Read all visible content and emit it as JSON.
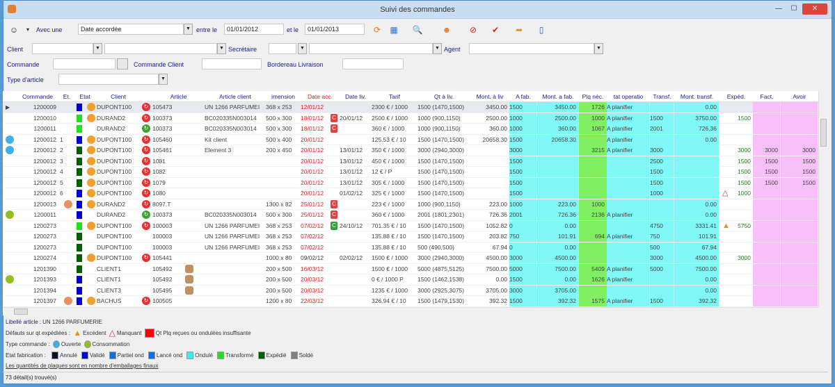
{
  "window": {
    "title": "Suivi des commandes",
    "close": "✕",
    "minimize": "—",
    "maximize": "☐"
  },
  "filters": {
    "avec_une": "Avec une",
    "date_type": "Date accordée",
    "entre_le": "entre le",
    "date_from": "01/01/2012",
    "et_le": "et le",
    "date_to": "01/01/2013",
    "client": "Client",
    "secretaire": "Secrétaire",
    "agent": "Agent",
    "commande": "Commande",
    "commande_client": "Commande Client",
    "bordereau": "Bordereau Livraison",
    "type_article": "Type d'article"
  },
  "columns": [
    "Commande",
    "Et.",
    "Etat",
    "Client",
    "Article",
    "Article client",
    "imension",
    "Date acc.",
    "Date liv.",
    "Tarif",
    "Qt à liv.",
    "Mont. à liv",
    "A fab.",
    "Mont. a fab.",
    "Plq néc.",
    "tat operatio",
    "Transf.",
    "Mont. transf.",
    "Expéd.",
    "Fact.",
    "Avoir"
  ],
  "rows": [
    {
      "cmd": "1200009",
      "et": "",
      "etat": "#0000d0",
      "lock": 1,
      "client": "DUPONT100",
      "ai": "r",
      "art": "105473",
      "artc": "UN 1266 PARFUMEI",
      "dim": "368 x 253",
      "dacc": "12/01/12",
      "badge": "",
      "dliv": "",
      "tarif": "2300 € / 1000",
      "qt": "1500 (1470,1500)",
      "mliv": "3450.00",
      "afab": "1500",
      "mfab": "3450.00",
      "plq": "1726",
      "op": "A planifier",
      "tr": "",
      "mtr": "0.00",
      "exp": "",
      "fact": "",
      "avoir": ""
    },
    {
      "cmd": "1200010",
      "et": "",
      "etat": "#20e020",
      "lock": 1,
      "client": "DURAND2",
      "ai": "r",
      "art": "100373",
      "artc": "BC020335N003014",
      "dim": "500 x 300",
      "dacc": "18/01/12",
      "badge": "r",
      "dliv": "20/01/12",
      "tarif": "2500 € / 1000",
      "qt": "1000 (900,1150)",
      "mliv": "2500.00",
      "afab": "1000",
      "mfab": "2500.00",
      "plq": "1000",
      "op": "A planifier",
      "tr": "1500",
      "mtr": "3750.00",
      "exp": "1500",
      "fact": "",
      "avoir": ""
    },
    {
      "cmd": "1200011",
      "et": "",
      "etat": "#20e020",
      "lock": 0,
      "client": "DURAND2",
      "ai": "g",
      "art": "100373",
      "artc": "BC020335N003014",
      "dim": "500 x 300",
      "dacc": "18/01/12",
      "badge": "r",
      "dliv": "",
      "tarif": "360 € / 1000",
      "qt": "1000 (900,1150)",
      "mliv": "360.00",
      "afab": "1000",
      "mfab": "360.00",
      "plq": "1067",
      "op": "A planifier",
      "tr": "2001",
      "mtr": "726.36",
      "exp": "",
      "fact": "",
      "avoir": ""
    },
    {
      "cmd": "1200012",
      "type": "o",
      "et": "1",
      "etat": "#0000d0",
      "lock": 1,
      "client": "DUPONT100",
      "ai": "r",
      "art": "105460",
      "artc": "Kit client",
      "dim": "500 x 400",
      "dacc": "20/01/12",
      "badge": "",
      "dliv": "",
      "tarif": "125.53 € / 10",
      "qt": "1500 (1470,1500)",
      "mliv": "20658.30",
      "afab": "1500",
      "mfab": "20658.30",
      "plq": "",
      "op": "A planifier",
      "tr": "",
      "mtr": "0.00",
      "exp": "",
      "fact": "",
      "avoir": ""
    },
    {
      "cmd": "1200012",
      "type": "o",
      "et": "2",
      "etat": "#006000",
      "lock": 1,
      "client": "DUPONT100",
      "ai": "r",
      "art": "105461",
      "artc": "Element 3",
      "dim": "200 x 450",
      "dacc": "20/01/12",
      "badge": "",
      "dliv": "13/01/12",
      "tarif": "350 € / 1000",
      "qt": "3000 (2940,3000)",
      "mliv": "",
      "afab": "3000",
      "mfab": "",
      "plq": "3215",
      "op": "A planifier",
      "tr": "3000",
      "mtr": "",
      "exp": "3000",
      "fact": "3000",
      "avoir": "3000"
    },
    {
      "cmd": "1200012",
      "et": "3",
      "etat": "#006000",
      "lock": 1,
      "client": "DUPONT100",
      "ai": "r",
      "art": "1081",
      "artc": "",
      "dim": "",
      "dacc": "20/01/12",
      "badge": "",
      "dliv": "13/01/12",
      "tarif": "450 € / 1000",
      "qt": "1500 (1470,1500)",
      "mliv": "",
      "afab": "1500",
      "mfab": "",
      "plq": "",
      "op": "",
      "tr": "2500",
      "mtr": "",
      "exp": "1500",
      "fact": "1500",
      "avoir": "1500"
    },
    {
      "cmd": "1200012",
      "et": "4",
      "etat": "#006000",
      "lock": 1,
      "client": "DUPONT100",
      "ai": "r",
      "art": "1082",
      "artc": "",
      "dim": "",
      "dacc": "20/01/12",
      "badge": "",
      "dliv": "13/01/12",
      "tarif": "12 € / P",
      "qt": "1500 (1470,1500)",
      "mliv": "",
      "afab": "1500",
      "mfab": "",
      "plq": "",
      "op": "",
      "tr": "1500",
      "mtr": "",
      "exp": "1500",
      "fact": "1500",
      "avoir": "1500"
    },
    {
      "cmd": "1200012",
      "et": "5",
      "etat": "#006000",
      "lock": 1,
      "client": "DUPONT100",
      "ai": "r",
      "art": "1079",
      "artc": "",
      "dim": "",
      "dacc": "20/01/12",
      "badge": "",
      "dliv": "13/01/12",
      "tarif": "305 € / 1000",
      "qt": "1500 (1470,1500)",
      "mliv": "",
      "afab": "1500",
      "mfab": "",
      "plq": "",
      "op": "",
      "tr": "1500",
      "mtr": "",
      "exp": "1500",
      "fact": "1500",
      "avoir": "1500"
    },
    {
      "cmd": "1200012",
      "et": "6",
      "etat": "#0000d0",
      "lock": 1,
      "client": "DUPONT100",
      "ai": "r",
      "art": "1080",
      "artc": "",
      "dim": "",
      "dacc": "20/01/12",
      "badge": "",
      "dliv": "01/02/12",
      "tarif": "325 € / 1000",
      "qt": "1500 (1470,1500)",
      "mliv": "",
      "afab": "1500",
      "mfab": "",
      "plq": "",
      "op": "",
      "tr": "1000",
      "mtr": "",
      "exp": "1000",
      "warn": "m",
      "fact": "",
      "avoir": ""
    },
    {
      "cmd": "1200013",
      "chat": 1,
      "et": "",
      "etat": "#0000d0",
      "lock": 1,
      "client": "DURAND2",
      "ai": "r",
      "art": "8097.T",
      "artc": "",
      "dim": "1300 x 82",
      "dacc": "25/01/12",
      "badge": "r",
      "dliv": "",
      "tarif": "223 € / 1000",
      "qt": "1000 (900,1150)",
      "mliv": "223.00",
      "afab": "1000",
      "mfab": "223.00",
      "plq": "1000",
      "op": "",
      "tr": "",
      "mtr": "0.00",
      "exp": "",
      "fact": "",
      "avoir": ""
    },
    {
      "cmd": "1200011",
      "type": "c",
      "et": "",
      "etat": "#0000d0",
      "lock": 0,
      "client": "DURAND2",
      "ai": "g",
      "art": "100373",
      "artc": "BC020335N003014",
      "dim": "500 x 300",
      "dacc": "25/01/12",
      "badge": "r",
      "dliv": "",
      "tarif": "360 € / 1000",
      "qt": "2001 (1801,2301)",
      "mliv": "726.36",
      "afab": "2001",
      "mfab": "726.36",
      "plq": "2136",
      "op": "A planifier",
      "tr": "",
      "mtr": "0.00",
      "exp": "",
      "fact": "",
      "avoir": ""
    },
    {
      "cmd": "1200273",
      "et": "",
      "etat": "#20e020",
      "lock": 1,
      "client": "DUPONT100",
      "ai": "r",
      "art": "100003",
      "artc": "UN 1266 PARFUMEI",
      "dim": "368 x 253",
      "dacc": "07/02/12",
      "badge": "g",
      "dliv": "24/10/12",
      "tarif": "701.35 € / 10",
      "qt": "1500 (1470,1500)",
      "mliv": "1052.82",
      "afab": "0",
      "mfab": "0.00",
      "plq": "",
      "op": "",
      "tr": "4750",
      "mtr": "3331.41",
      "exp": "5750",
      "warn": "e",
      "fact": "",
      "avoir": ""
    },
    {
      "cmd": "1200273",
      "et": "",
      "etat": "#006000",
      "lock": 0,
      "client": "DUPONT100",
      "ai": "",
      "art": "100003",
      "artc": "UN 1266 PARFUMEI",
      "dim": "368 x 253",
      "dacc": "07/02/12",
      "badge": "",
      "dliv": "",
      "tarif": "135.88 € / 10",
      "qt": "1500 (1470,1500)",
      "mliv": "203.82",
      "afab": "750",
      "mfab": "101.91",
      "plq": "694",
      "op": "A planifier",
      "tr": "750",
      "mtr": "101.91",
      "exp": "",
      "fact": "",
      "avoir": ""
    },
    {
      "cmd": "1200273",
      "et": "",
      "etat": "#006000",
      "lock": 0,
      "client": "DUPONT100",
      "ai": "",
      "art": "100003",
      "artc": "UN 1266 PARFUMEI",
      "dim": "368 x 253",
      "dacc": "07/02/12",
      "badge": "",
      "dliv": "",
      "tarif": "135.88 € / 10",
      "qt": "500 (490,500)",
      "mliv": "67.94",
      "afab": "0",
      "mfab": "0.00",
      "plq": "",
      "op": "",
      "tr": "500",
      "mtr": "67.94",
      "exp": "",
      "fact": "",
      "avoir": ""
    },
    {
      "cmd": "1200274",
      "et": "",
      "etat": "#006000",
      "lock": 1,
      "client": "DUPONT100",
      "ai": "r",
      "art": "105441",
      "artc": "",
      "dim": "1000 x 80",
      "dacc": "09/02/12",
      "dark": 1,
      "badge": "",
      "dliv": "02/02/12",
      "tarif": "1500 € / 1000",
      "qt": "3000 (2940,3000)",
      "mliv": "4500.00",
      "afab": "3000",
      "mfab": "4500.00",
      "plq": "",
      "op": "",
      "tr": "3000",
      "mtr": "4500.00",
      "exp": "3000",
      "fact": "",
      "avoir": ""
    },
    {
      "cmd": "1201390",
      "et": "",
      "etat": "#006000",
      "lock": 0,
      "client": "CLIENT1",
      "ai": "",
      "art": "105492",
      "kit": 1,
      "artc": "",
      "dim": "200 x 500",
      "dacc": "16/03/12",
      "badge": "",
      "dliv": "",
      "tarif": "1500 € / 1000",
      "qt": "5000 (4875,5125)",
      "mliv": "7500.00",
      "afab": "5000",
      "mfab": "7500.00",
      "plq": "5409",
      "op": "A planifier",
      "tr": "5000",
      "mtr": "7500.00",
      "exp": "",
      "fact": "",
      "avoir": ""
    },
    {
      "cmd": "1201393",
      "type": "c",
      "et": "",
      "etat": "#0000d0",
      "lock": 0,
      "client": "CLIENT1",
      "ai": "",
      "art": "105492",
      "kit": 1,
      "artc": "",
      "dim": "200 x 500",
      "dacc": "20/03/12",
      "badge": "",
      "dliv": "",
      "tarif": "0 € / 1000 P",
      "qt": "1500 (1462,1538)",
      "mliv": "0.00",
      "afab": "1500",
      "mfab": "0.00",
      "plq": "1626",
      "op": "A planifier",
      "tr": "",
      "mtr": "0.00",
      "exp": "",
      "fact": "",
      "avoir": ""
    },
    {
      "cmd": "1201394",
      "et": "",
      "etat": "#0000d0",
      "lock": 0,
      "client": "CLIENT3",
      "ai": "",
      "art": "105495",
      "kit": 1,
      "artc": "",
      "dim": "200 x 500",
      "dacc": "20/03/12",
      "badge": "",
      "dliv": "",
      "tarif": "1235 € / 1000",
      "qt": "3000 (2925,3075)",
      "mliv": "3705.00",
      "afab": "3000",
      "mfab": "3705.00",
      "plq": "",
      "op": "",
      "tr": "",
      "mtr": "0.00",
      "exp": "",
      "fact": "",
      "avoir": ""
    },
    {
      "cmd": "1201397",
      "chat": 1,
      "et": "",
      "etat": "#0000d0",
      "lock": 1,
      "client": "BACHUS",
      "ai": "r",
      "art": "100505",
      "artc": "",
      "dim": "1200 x 80",
      "dacc": "22/03/12",
      "badge": "",
      "dliv": "",
      "tarif": "326.94 € / 10",
      "qt": "1500 (1479,1530)",
      "mliv": "392.32",
      "afab": "1500",
      "mfab": "392.32",
      "plq": "1575",
      "op": "A planifier",
      "tr": "1500",
      "mtr": "392.32",
      "exp": "",
      "fact": "",
      "avoir": ""
    }
  ],
  "legend": {
    "libelle_label": "Libellé article :",
    "libelle_value": "UN 1266 PARFUMERIE",
    "defauts_label": "Défauts sur qt expédiées :",
    "excedent": "Excédent",
    "manquant": "Manquant",
    "insuffisante": "Qt Plq reçues ou ondulées insuffisante",
    "type_label": "Type commande :",
    "ouverte": "Ouverte",
    "consommation": "Consommation",
    "etat_label": "Etat fabrication :",
    "etats": [
      {
        "label": "Annulé",
        "color": "#101020"
      },
      {
        "label": "Validé",
        "color": "#0000e0"
      },
      {
        "label": "Partiel ond",
        "color": "#1070e0"
      },
      {
        "label": "Lancé ond",
        "color": "#1070e0"
      },
      {
        "label": "Ondulé",
        "color": "#30f0f0"
      },
      {
        "label": "Transformé",
        "color": "#20e020"
      },
      {
        "label": "Expédié",
        "color": "#006000"
      },
      {
        "label": "Soldé",
        "color": "#808080"
      }
    ],
    "note": "Les quantités de plaques sont en nombre d'emballages finaux"
  },
  "status": "73 détail(s) trouvé(s)"
}
